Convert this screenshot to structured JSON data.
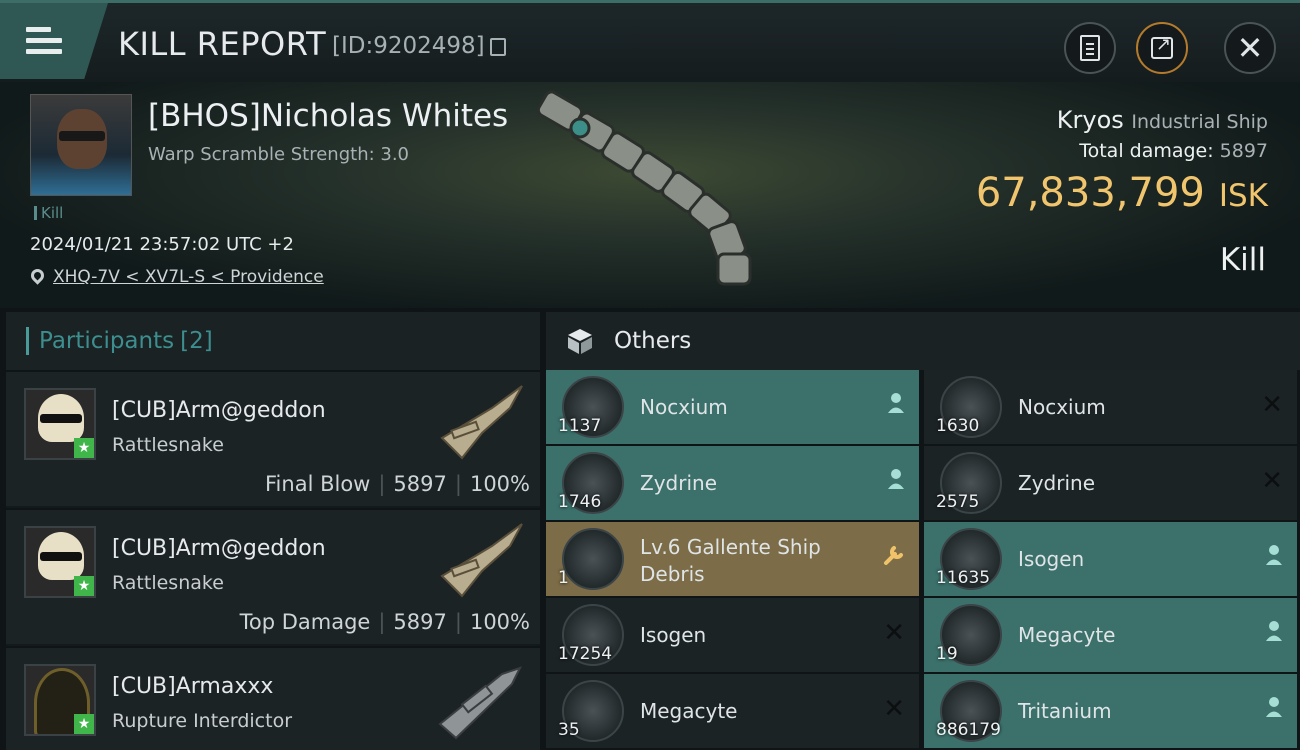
{
  "header": {
    "title": "KILL REPORT",
    "report_id": "[ID:9202498]"
  },
  "victim": {
    "name": "[BHOS]Nicholas Whites",
    "warp_scramble": "Warp Scramble Strength: 3.0",
    "tag": "Kill",
    "datetime": "2024/01/21 23:57:02 UTC +2",
    "location": "XHQ-7V < XV7L-S < Providence",
    "ship_name": "Kryos",
    "ship_class": "Industrial Ship",
    "total_damage_label": "Total damage:",
    "total_damage": "5897",
    "isk_value": "67,833,799",
    "isk_unit": "ISK",
    "result": "Kill"
  },
  "participants": {
    "label": "Participants",
    "count": "[2]",
    "rows": [
      {
        "name": "[CUB]Arm@geddon",
        "ship": "Rattlesnake",
        "role": "Final Blow",
        "damage": "5897",
        "percent": "100%"
      },
      {
        "name": "[CUB]Arm@geddon",
        "ship": "Rattlesnake",
        "role": "Top Damage",
        "damage": "5897",
        "percent": "100%"
      },
      {
        "name": "[CUB]Armaxxx",
        "ship": "Rupture Interdictor"
      }
    ]
  },
  "others": {
    "label": "Others",
    "items": [
      {
        "name": "Nocxium",
        "qty": "1137",
        "action": "person"
      },
      {
        "name": "Nocxium",
        "qty": "1630",
        "action": "x"
      },
      {
        "name": "Zydrine",
        "qty": "1746",
        "action": "person"
      },
      {
        "name": "Zydrine",
        "qty": "2575",
        "action": "x"
      },
      {
        "name": "Lv.6 Gallente Ship Debris",
        "qty": "1",
        "action": "wrench"
      },
      {
        "name": "Isogen",
        "qty": "11635",
        "action": "person"
      },
      {
        "name": "Isogen",
        "qty": "17254",
        "action": "x"
      },
      {
        "name": "Megacyte",
        "qty": "19",
        "action": "person"
      },
      {
        "name": "Megacyte",
        "qty": "35",
        "action": "x"
      },
      {
        "name": "Tritanium",
        "qty": "886179",
        "action": "person"
      }
    ]
  },
  "colors": {
    "accent_teal": "#3b706b",
    "isk_gold": "#f1c56d",
    "debris_gold": "#7c6c47",
    "star_green": "#3fb54a"
  }
}
